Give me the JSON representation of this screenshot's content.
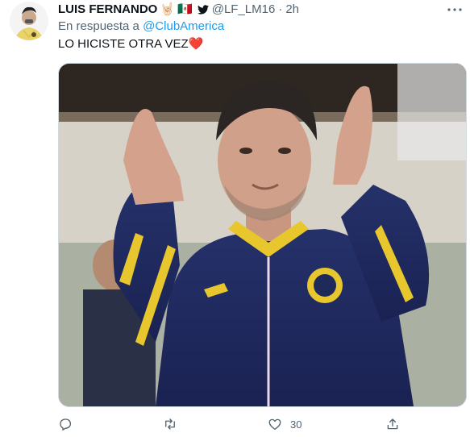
{
  "tweet": {
    "author_name": "LUIS FERNANDO",
    "author_emojis": [
      "🤘🏻",
      "🇲🇽"
    ],
    "verified_badge_icon": "twitter-bird-icon",
    "handle": "@LF_LM16",
    "separator": "·",
    "time": "2h",
    "reply_prefix": "En respuesta a",
    "reply_mention": "@ClubAmerica",
    "text": "LO HICISTE OTRA VEZ",
    "text_emoji": "❤️",
    "actions": {
      "like_count": "30"
    }
  },
  "colors": {
    "text_primary": "#0f1419",
    "text_secondary": "#536471",
    "link": "#1d9bf0",
    "heart": "#e0245e"
  }
}
